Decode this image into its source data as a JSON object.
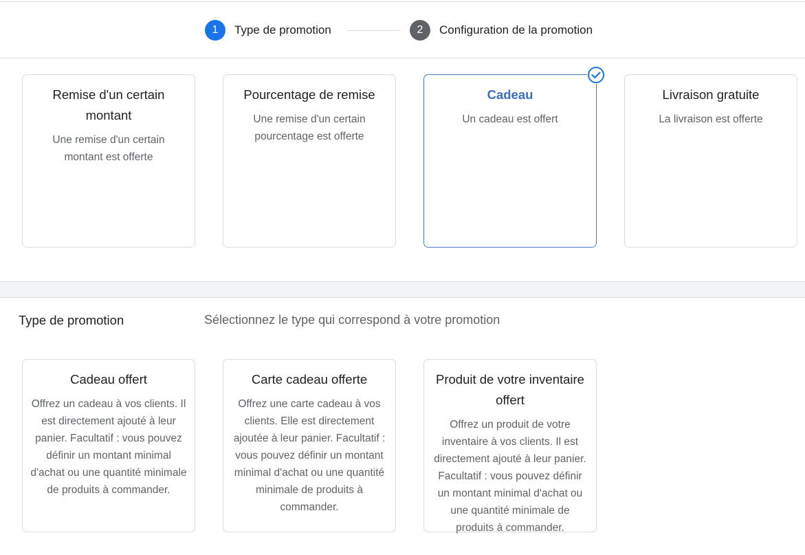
{
  "stepper": {
    "steps": [
      {
        "number": "1",
        "label": "Type de promotion",
        "state": "active"
      },
      {
        "number": "2",
        "label": "Configuration de la promotion",
        "state": "inactive"
      }
    ]
  },
  "promotion_types": [
    {
      "title": "Remise d'un certain montant",
      "description": "Une remise d'un certain montant est offerte",
      "selected": false
    },
    {
      "title": "Pourcentage de remise",
      "description": "Une remise d'un certain pourcentage est offerte",
      "selected": false
    },
    {
      "title": "Cadeau",
      "description": "Un cadeau est offert",
      "selected": true,
      "badge_icon": "check-circle-icon"
    },
    {
      "title": "Livraison gratuite",
      "description": "La livraison est offerte",
      "selected": false
    }
  ],
  "section": {
    "label": "Type de promotion",
    "hint": "Sélectionnez le type qui correspond à votre promotion"
  },
  "gift_types": [
    {
      "title": "Cadeau offert",
      "description": "Offrez un cadeau à vos clients. Il est directement ajouté à leur panier. Facultatif : vous pouvez définir un montant minimal d'achat ou une quantité minimale de produits à commander."
    },
    {
      "title": "Carte cadeau offerte",
      "description": "Offrez une carte cadeau à vos clients. Elle est directement ajoutée à leur panier. Facultatif : vous pouvez définir un montant minimal d'achat ou une quantité minimale de produits à commander."
    },
    {
      "title": "Produit de votre inventaire offert",
      "description": "Offrez un produit de votre inventaire à vos clients. Il est directement ajouté à leur panier. Facultatif : vous pouvez définir un montant minimal d'achat ou une quantité minimale de produits à commander."
    }
  ],
  "colors": {
    "accent": "#1a73e8",
    "selected_border": "#4a79c4",
    "selected_title": "#3b6fc4",
    "inactive_step": "#5f6368",
    "border": "#dadce0",
    "band": "#f1f3f4"
  }
}
